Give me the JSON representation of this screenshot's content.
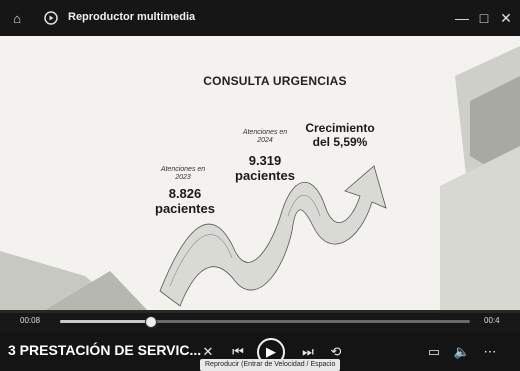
{
  "app": {
    "title": "Reproductor multimedia"
  },
  "slide": {
    "title": "CONSULTA URGENCIAS",
    "left_label": "Atenciones en 2023",
    "left_value": "8.826",
    "left_unit": "pacientes",
    "mid_label": "Atenciones en 2024",
    "mid_value": "9.319",
    "mid_unit": "pacientes",
    "growth_line1": "Crecimiento",
    "growth_line2": "del 5,59%"
  },
  "player": {
    "elapsed": "00:08",
    "remaining": "00:4",
    "progress": 0.22,
    "media_title": "3 PRESTACIÓN DE SERVIC...",
    "tooltip": "Reproducir (Entrar de Velocidad / Espacio"
  },
  "icons": {
    "home": "home-icon",
    "app_logo": "media-player-icon",
    "shuffle": "shuffle-icon",
    "previous": "previous-icon",
    "play": "play-icon",
    "next": "next-icon",
    "repeat": "repeat-icon",
    "subtitles": "subtitles-icon",
    "volume": "volume-icon",
    "more": "more-icon"
  },
  "colors": {
    "title_bar": "#161616",
    "slide_background": "#f3f2ee",
    "arrow_fill": "#dadad5",
    "controls_background": "#141414"
  }
}
